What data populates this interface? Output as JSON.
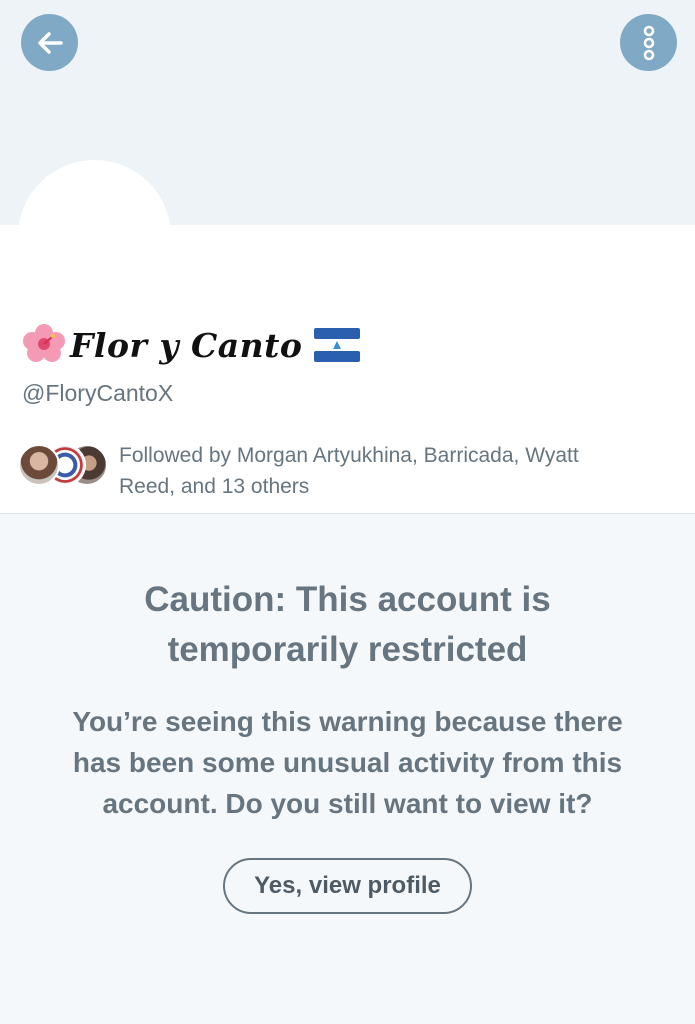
{
  "header": {
    "back_icon": "arrow-left-icon",
    "more_icon": "more-vertical-icon",
    "button_color": "#7fa9c4"
  },
  "profile": {
    "name_prefix_emoji": "🌺",
    "display_name": "Flor y Canto",
    "flag": "nicaragua-flag",
    "handle": "@FloryCantoX",
    "followed_by": "Followed by Morgan Artyukhina, Barricada, Wyatt Reed, and 13 others"
  },
  "warning": {
    "title": "Caution: This account is temporarily restricted",
    "body": "You’re seeing this warning because there has been some unusual activity from this account. Do you still want to view it?",
    "button_label": "Yes, view profile"
  },
  "colors": {
    "text_secondary": "#66757f",
    "background": "#f5f8fa"
  }
}
